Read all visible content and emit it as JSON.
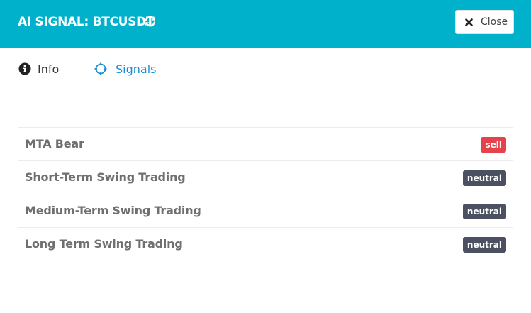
{
  "header": {
    "title": "AI SIGNAL: BTCUSDT",
    "refresh_icon": "refresh-icon",
    "close_label": "Close",
    "close_icon": "close-icon",
    "background_color": "#00b1cc"
  },
  "tabs": [
    {
      "label": "Info",
      "icon": "info-circle-icon",
      "active": false
    },
    {
      "label": "Signals",
      "icon": "crosshair-icon",
      "active": true,
      "color": "#1a8fd6"
    }
  ],
  "signals": [
    {
      "name": "MTA Bear",
      "status": "sell",
      "color": "#e5434b"
    },
    {
      "name": "Short-Term Swing Trading",
      "status": "neutral",
      "color": "#4c5162"
    },
    {
      "name": "Medium-Term Swing Trading",
      "status": "neutral",
      "color": "#4c5162"
    },
    {
      "name": "Long Term Swing Trading",
      "status": "neutral",
      "color": "#4c5162"
    }
  ]
}
